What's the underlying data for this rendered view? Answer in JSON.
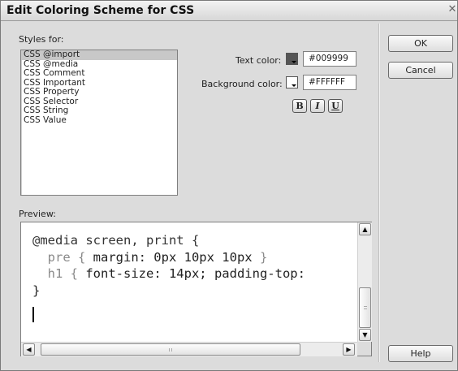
{
  "window": {
    "title": "Edit Coloring Scheme for CSS",
    "close_glyph": "✕"
  },
  "styles": {
    "label": "Styles for:",
    "items": [
      "CSS @import",
      "CSS @media",
      "CSS Comment",
      "CSS Important",
      "CSS Property",
      "CSS Selector",
      "CSS String",
      "CSS Value"
    ],
    "selected_index": 0
  },
  "text_color": {
    "label": "Text color:",
    "value": "#009999",
    "swatch_color": "#555555"
  },
  "background_color": {
    "label": "Background color:",
    "value": "#FFFFFF",
    "swatch_color": "#FFFFFF"
  },
  "format_buttons": {
    "bold": "B",
    "italic": "I",
    "underline": "U"
  },
  "buttons": {
    "ok": "OK",
    "cancel": "Cancel",
    "help": "Help"
  },
  "preview": {
    "label": "Preview:",
    "lines": {
      "l1": "@media screen, print {",
      "l2a": "  pre { ",
      "l2b": "margin: 0px 10px 10px",
      "l2c": " }",
      "l3a": "  h1 { ",
      "l3b": "font-size: 14px; padding-top:",
      "l4": "}"
    }
  },
  "scrollbar": {
    "up": "▲",
    "down": "▼",
    "left": "◀",
    "right": "▶"
  }
}
